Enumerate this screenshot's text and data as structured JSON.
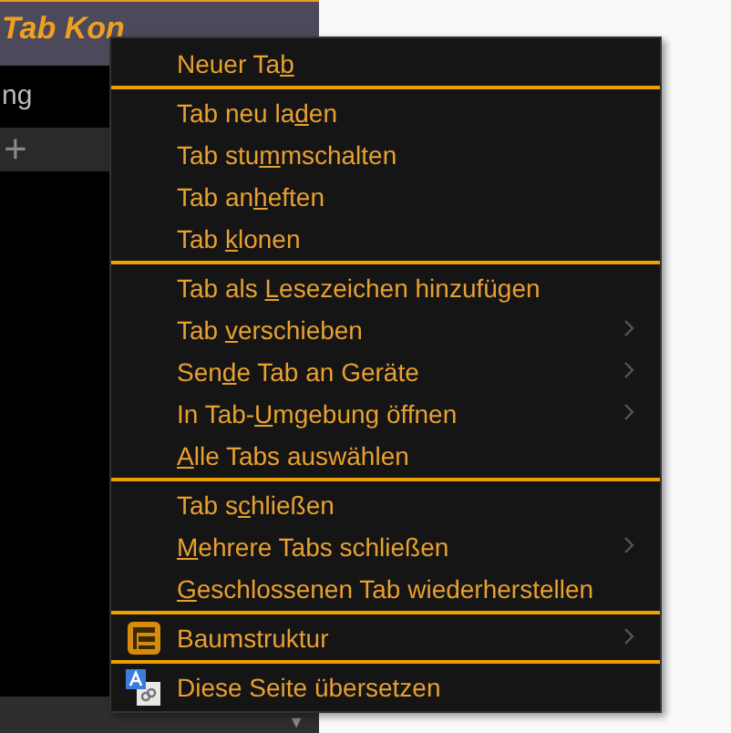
{
  "window": {
    "title": "Tab Kon"
  },
  "sidebar": {
    "cut_text": "ng",
    "new_tab_button": "+",
    "dropdown": "▼"
  },
  "context_menu": {
    "groups": [
      {
        "items": [
          {
            "before": "Neuer Ta",
            "key": "b",
            "submenu": false
          }
        ]
      },
      {
        "items": [
          {
            "before": "Tab neu la",
            "key": "d",
            "after": "en",
            "submenu": false
          },
          {
            "before": "Tab stu",
            "key": "m",
            "after": "mschalten",
            "submenu": false
          },
          {
            "before": "Tab an",
            "key": "h",
            "after": "eften",
            "submenu": false
          },
          {
            "before": "Tab ",
            "key": "k",
            "after": "lonen",
            "submenu": false
          }
        ]
      },
      {
        "items": [
          {
            "before": "Tab als ",
            "key": "L",
            "after": "esezeichen hinzufügen",
            "submenu": false
          },
          {
            "before": "Tab ",
            "key": "v",
            "after": "erschieben",
            "submenu": true
          },
          {
            "before": "Sen",
            "key": "d",
            "after": "e Tab an Geräte",
            "submenu": true
          },
          {
            "before": "In Tab-",
            "key": "U",
            "after": "mgebung öffnen",
            "submenu": true
          },
          {
            "key": "A",
            "after": "lle Tabs auswählen",
            "submenu": false
          }
        ]
      },
      {
        "items": [
          {
            "before": "Tab s",
            "key": "c",
            "after": "hließen",
            "submenu": false
          },
          {
            "key": "M",
            "after": "ehrere Tabs schließen",
            "submenu": true
          },
          {
            "key": "G",
            "after": "eschlossenen Tab wiederherstellen",
            "submenu": false
          }
        ]
      },
      {
        "items": [
          {
            "after": "Baumstruktur",
            "kind": "tree",
            "submenu": true
          }
        ]
      },
      {
        "items": [
          {
            "after": "Diese Seite übersetzen",
            "kind": "translate",
            "submenu": false
          }
        ]
      }
    ]
  }
}
